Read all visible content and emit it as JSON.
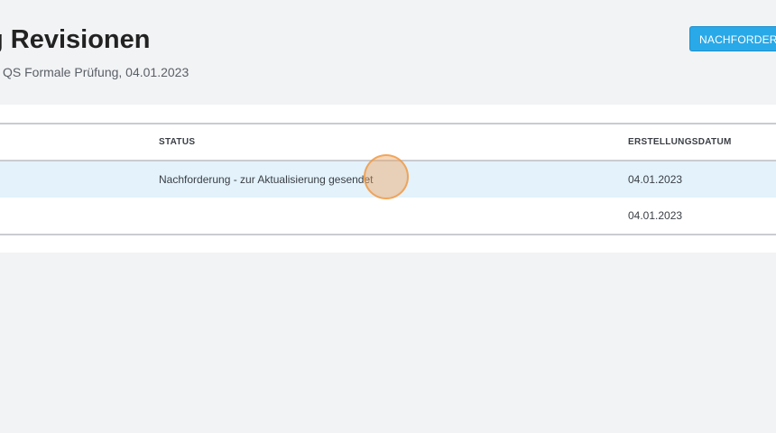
{
  "header": {
    "title": "g Revisionen",
    "subtitle": "QS Formale Prüfung, 04.01.2023",
    "action_button": "NACHFORDERU"
  },
  "table": {
    "columns": {
      "status": "STATUS",
      "created": "ERSTELLUNGSDATUM"
    },
    "rows": [
      {
        "status": "Nachforderung - zur Aktualisierung gesendet",
        "created": "04.01.2023",
        "highlighted": true
      },
      {
        "status": "",
        "created": "04.01.2023",
        "highlighted": false
      }
    ]
  },
  "colors": {
    "accent": "#29a9e8",
    "row_highlight": "#e3f2fb",
    "background": "#f2f3f5",
    "click_marker": "#eba05a"
  }
}
